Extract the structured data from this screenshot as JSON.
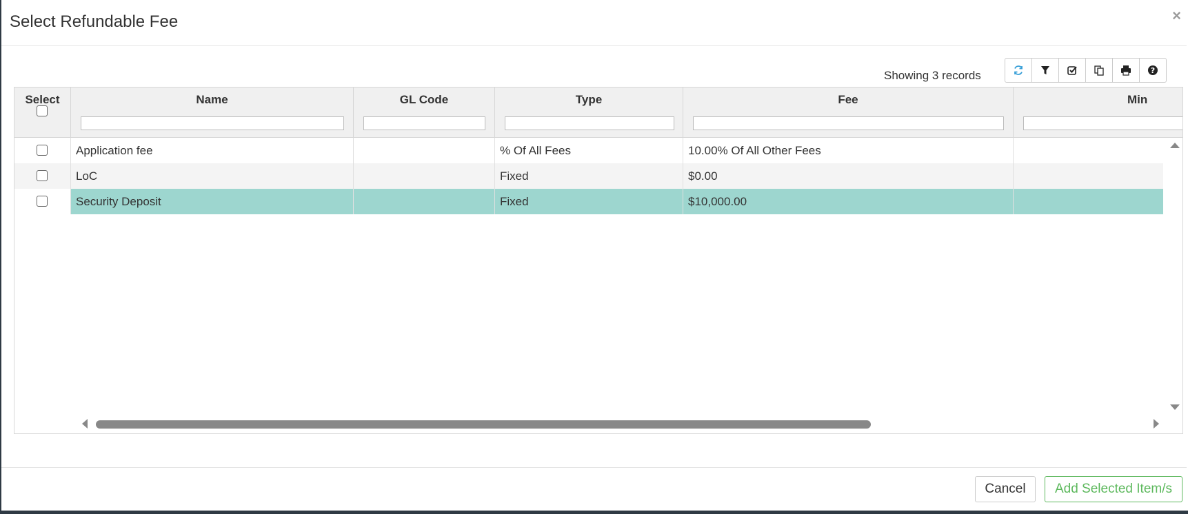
{
  "dialog": {
    "title": "Select Refundable Fee",
    "close_symbol": "×"
  },
  "grid": {
    "record_count_text": "Showing 3 records",
    "toolbar_icons": [
      "refresh-icon",
      "filter-icon",
      "check-square-icon",
      "copy-icon",
      "print-icon",
      "help-icon"
    ],
    "columns": {
      "select": "Select",
      "name": "Name",
      "gl_code": "GL Code",
      "type": "Type",
      "fee": "Fee",
      "min": "Min"
    },
    "rows": [
      {
        "name": "Application fee",
        "gl_code": "",
        "type": "% Of All Fees",
        "fee": "10.00% Of All Other Fees",
        "selected": false,
        "highlighted": false
      },
      {
        "name": "LoC",
        "gl_code": "",
        "type": "Fixed",
        "fee": "$0.00",
        "selected": false,
        "highlighted": false
      },
      {
        "name": "Security Deposit",
        "gl_code": "",
        "type": "Fixed",
        "fee": "$10,000.00",
        "selected": false,
        "highlighted": true
      }
    ]
  },
  "footer": {
    "cancel_label": "Cancel",
    "add_label": "Add Selected Item/s"
  },
  "colors": {
    "highlight_row": "#9dd6cf",
    "add_button": "#5cb85c",
    "refresh_icon": "#3aa0d8"
  }
}
